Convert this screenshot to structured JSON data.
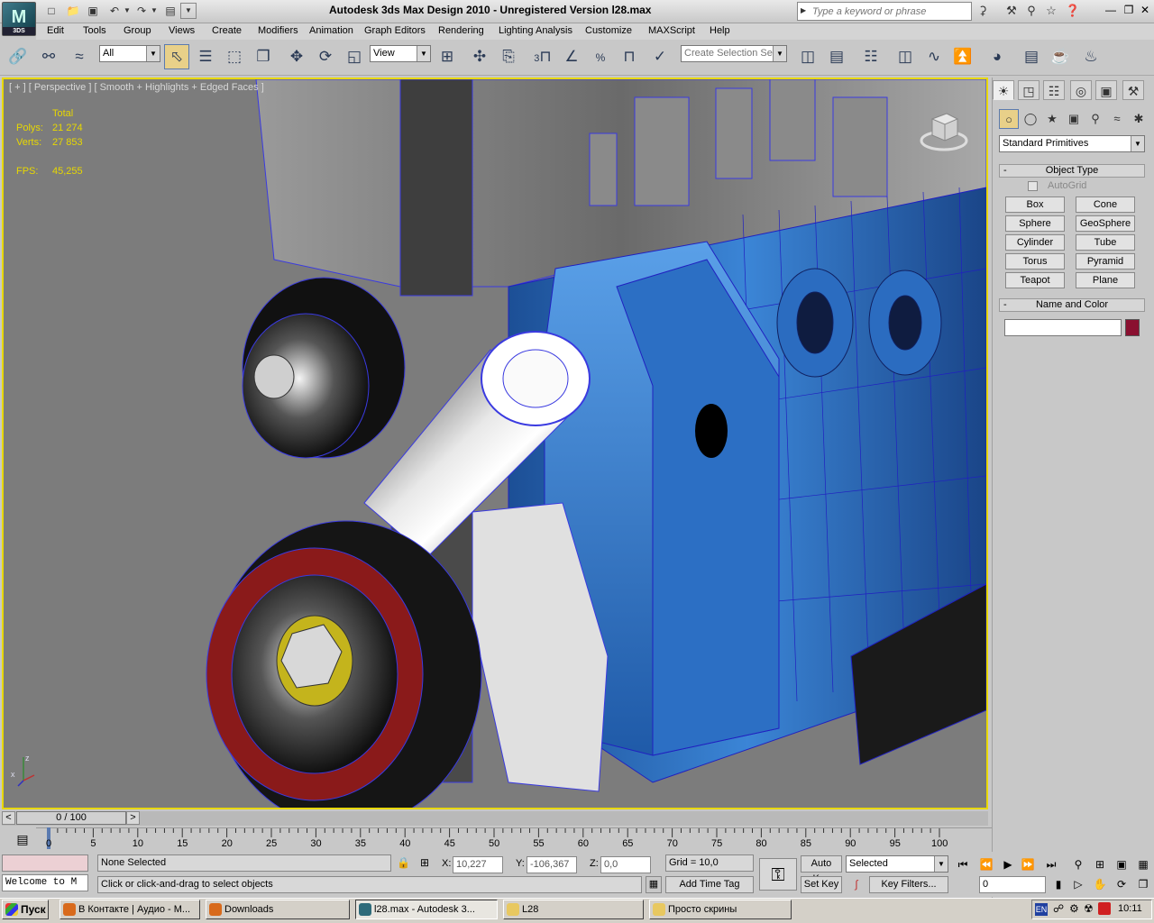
{
  "titlebar": {
    "logo_text": "3DS",
    "title": "Autodesk 3ds Max Design 2010   -   Unregistered Version      l28.max",
    "search_placeholder": "Type a keyword or phrase"
  },
  "menu": [
    "Edit",
    "Tools",
    "Group",
    "Views",
    "Create",
    "Modifiers",
    "Animation",
    "Graph Editors",
    "Rendering",
    "Lighting Analysis",
    "Customize",
    "MAXScript",
    "Help"
  ],
  "toolbar": {
    "selection_filter": "All",
    "ref_coord": "View",
    "snap_angle": "3",
    "snap_percent": "%",
    "selection_set_placeholder": "Create Selection Se"
  },
  "viewport": {
    "label": "[ + ] [ Perspective ] [ Smooth + Highlights + Edged Faces ]",
    "stats_header": "Total",
    "polys_label": "Polys:",
    "polys_value": "21 274",
    "verts_label": "Verts:",
    "verts_value": "27 853",
    "fps_label": "FPS:",
    "fps_value": "45,255",
    "axis_z": "z",
    "axis_x": "x"
  },
  "command_panel": {
    "category": "Standard Primitives",
    "object_type_title": "Object Type",
    "autogrid_label": "AutoGrid",
    "primitives": [
      "Box",
      "Cone",
      "Sphere",
      "GeoSphere",
      "Cylinder",
      "Tube",
      "Torus",
      "Pyramid",
      "Teapot",
      "Plane"
    ],
    "name_color_title": "Name and Color",
    "name_value": "",
    "color": "#8a1030"
  },
  "timeline": {
    "frame_display": "0 / 100",
    "ticks": [
      "0",
      "5",
      "10",
      "15",
      "20",
      "25",
      "30",
      "35",
      "40",
      "45",
      "50",
      "55",
      "60",
      "65",
      "70",
      "75",
      "80",
      "85",
      "90",
      "95",
      "100"
    ]
  },
  "status": {
    "selection": "None Selected",
    "prompt": "Click or click-and-drag to select objects",
    "maxscript": "Welcome to M",
    "x_label": "X:",
    "x_value": "10,227",
    "y_label": "Y:",
    "y_value": "-106,367",
    "z_label": "Z:",
    "z_value": "0,0",
    "grid": "Grid = 10,0",
    "add_time_tag": "Add Time Tag",
    "auto_key": "Auto Key",
    "set_key": "Set Key",
    "key_mode": "Selected",
    "key_filters": "Key Filters...",
    "current_frame": "0"
  },
  "taskbar": {
    "start": "Пуск",
    "tasks": [
      {
        "label": "В Контакте | Аудио - M...",
        "icon_color": "#d86a1c"
      },
      {
        "label": "Downloads",
        "icon_color": "#d86a1c"
      },
      {
        "label": "l28.max - Autodesk 3...",
        "icon_color": "#2e6b7a"
      },
      {
        "label": "L28",
        "icon_color": "#e8c860"
      },
      {
        "label": "Просто скрины",
        "icon_color": "#e8c860"
      }
    ],
    "lang": "EN",
    "clock": "10:11"
  },
  "colors": {
    "viewport_border": "#e8d800",
    "stats_text": "#e8d800",
    "active_tool": "#e8d089",
    "engine_blue": "#2f73c8"
  }
}
